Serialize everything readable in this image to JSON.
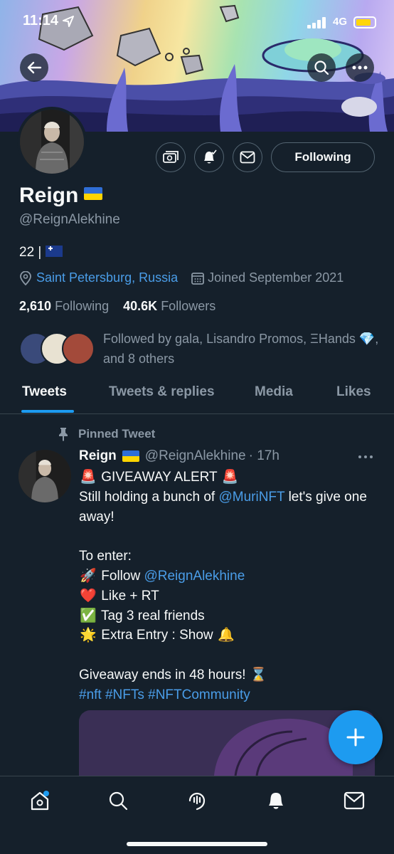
{
  "status": {
    "time": "11:14",
    "network": "4G"
  },
  "profile": {
    "name": "Reign",
    "handle": "@ReignAlekhine",
    "bio": "22 |",
    "location": "Saint Petersburg, Russia",
    "joined": "Joined September 2021",
    "following_count": "2,610",
    "following_label": "Following",
    "followers_count": "40.6K",
    "followers_label": "Followers",
    "followed_by": "Followed by gala, Lisandro Promos, ΞHands 💎, and 8 others",
    "follow_button": "Following"
  },
  "tabs": [
    "Tweets",
    "Tweets & replies",
    "Media",
    "Likes"
  ],
  "tweet": {
    "pinned_label": "Pinned Tweet",
    "author_name": "Reign",
    "author_handle": "@ReignAlekhine",
    "time": "· 17h",
    "line1": "GIVEAWAY ALERT",
    "line2a": "Still holding a bunch of",
    "mention1": "@MuriNFT",
    "line2b": "let's give one away!",
    "line3": "To enter:",
    "line4a": "Follow",
    "mention2": "@ReignAlekhine",
    "line5": "Like + RT",
    "line6": "Tag 3 real friends",
    "line7": "Extra Entry : Show",
    "line8": "Giveaway ends in 48 hours!",
    "hashtags": "#nft #NFTs #NFTCommunity"
  },
  "emoji": {
    "siren": "🚨",
    "rocket": "🚀",
    "heart": "❤️",
    "check": "✅",
    "star": "🌟",
    "bell": "🔔",
    "hourglass": "⌛"
  },
  "colors": {
    "background": "#15202b",
    "accent": "#1d9bf0",
    "link": "#4a9de8",
    "muted": "#8b98a5"
  },
  "icons": [
    "back-arrow-icon",
    "search-icon",
    "more-icon",
    "money-icon",
    "notification-bell-icon",
    "mail-icon",
    "location-icon",
    "calendar-icon",
    "pin-icon",
    "compose-plus-icon",
    "home-icon",
    "spaces-icon",
    "bell-icon"
  ]
}
